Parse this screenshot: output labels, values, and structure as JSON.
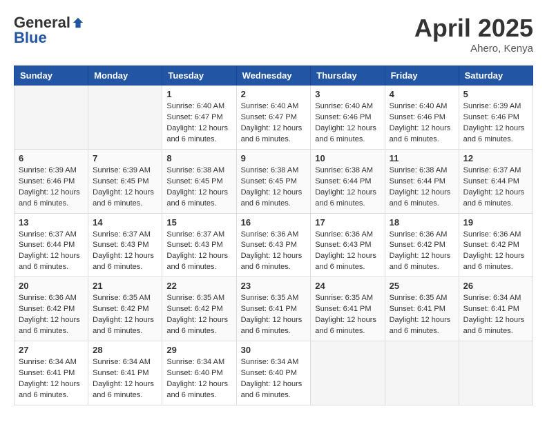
{
  "header": {
    "logo_general": "General",
    "logo_blue": "Blue",
    "month_title": "April 2025",
    "location": "Ahero, Kenya"
  },
  "columns": [
    "Sunday",
    "Monday",
    "Tuesday",
    "Wednesday",
    "Thursday",
    "Friday",
    "Saturday"
  ],
  "weeks": [
    [
      {
        "day": "",
        "info": ""
      },
      {
        "day": "",
        "info": ""
      },
      {
        "day": "1",
        "info": "Sunrise: 6:40 AM\nSunset: 6:47 PM\nDaylight: 12 hours and 6 minutes."
      },
      {
        "day": "2",
        "info": "Sunrise: 6:40 AM\nSunset: 6:47 PM\nDaylight: 12 hours and 6 minutes."
      },
      {
        "day": "3",
        "info": "Sunrise: 6:40 AM\nSunset: 6:46 PM\nDaylight: 12 hours and 6 minutes."
      },
      {
        "day": "4",
        "info": "Sunrise: 6:40 AM\nSunset: 6:46 PM\nDaylight: 12 hours and 6 minutes."
      },
      {
        "day": "5",
        "info": "Sunrise: 6:39 AM\nSunset: 6:46 PM\nDaylight: 12 hours and 6 minutes."
      }
    ],
    [
      {
        "day": "6",
        "info": "Sunrise: 6:39 AM\nSunset: 6:46 PM\nDaylight: 12 hours and 6 minutes."
      },
      {
        "day": "7",
        "info": "Sunrise: 6:39 AM\nSunset: 6:45 PM\nDaylight: 12 hours and 6 minutes."
      },
      {
        "day": "8",
        "info": "Sunrise: 6:38 AM\nSunset: 6:45 PM\nDaylight: 12 hours and 6 minutes."
      },
      {
        "day": "9",
        "info": "Sunrise: 6:38 AM\nSunset: 6:45 PM\nDaylight: 12 hours and 6 minutes."
      },
      {
        "day": "10",
        "info": "Sunrise: 6:38 AM\nSunset: 6:44 PM\nDaylight: 12 hours and 6 minutes."
      },
      {
        "day": "11",
        "info": "Sunrise: 6:38 AM\nSunset: 6:44 PM\nDaylight: 12 hours and 6 minutes."
      },
      {
        "day": "12",
        "info": "Sunrise: 6:37 AM\nSunset: 6:44 PM\nDaylight: 12 hours and 6 minutes."
      }
    ],
    [
      {
        "day": "13",
        "info": "Sunrise: 6:37 AM\nSunset: 6:44 PM\nDaylight: 12 hours and 6 minutes."
      },
      {
        "day": "14",
        "info": "Sunrise: 6:37 AM\nSunset: 6:43 PM\nDaylight: 12 hours and 6 minutes."
      },
      {
        "day": "15",
        "info": "Sunrise: 6:37 AM\nSunset: 6:43 PM\nDaylight: 12 hours and 6 minutes."
      },
      {
        "day": "16",
        "info": "Sunrise: 6:36 AM\nSunset: 6:43 PM\nDaylight: 12 hours and 6 minutes."
      },
      {
        "day": "17",
        "info": "Sunrise: 6:36 AM\nSunset: 6:43 PM\nDaylight: 12 hours and 6 minutes."
      },
      {
        "day": "18",
        "info": "Sunrise: 6:36 AM\nSunset: 6:42 PM\nDaylight: 12 hours and 6 minutes."
      },
      {
        "day": "19",
        "info": "Sunrise: 6:36 AM\nSunset: 6:42 PM\nDaylight: 12 hours and 6 minutes."
      }
    ],
    [
      {
        "day": "20",
        "info": "Sunrise: 6:36 AM\nSunset: 6:42 PM\nDaylight: 12 hours and 6 minutes."
      },
      {
        "day": "21",
        "info": "Sunrise: 6:35 AM\nSunset: 6:42 PM\nDaylight: 12 hours and 6 minutes."
      },
      {
        "day": "22",
        "info": "Sunrise: 6:35 AM\nSunset: 6:42 PM\nDaylight: 12 hours and 6 minutes."
      },
      {
        "day": "23",
        "info": "Sunrise: 6:35 AM\nSunset: 6:41 PM\nDaylight: 12 hours and 6 minutes."
      },
      {
        "day": "24",
        "info": "Sunrise: 6:35 AM\nSunset: 6:41 PM\nDaylight: 12 hours and 6 minutes."
      },
      {
        "day": "25",
        "info": "Sunrise: 6:35 AM\nSunset: 6:41 PM\nDaylight: 12 hours and 6 minutes."
      },
      {
        "day": "26",
        "info": "Sunrise: 6:34 AM\nSunset: 6:41 PM\nDaylight: 12 hours and 6 minutes."
      }
    ],
    [
      {
        "day": "27",
        "info": "Sunrise: 6:34 AM\nSunset: 6:41 PM\nDaylight: 12 hours and 6 minutes."
      },
      {
        "day": "28",
        "info": "Sunrise: 6:34 AM\nSunset: 6:41 PM\nDaylight: 12 hours and 6 minutes."
      },
      {
        "day": "29",
        "info": "Sunrise: 6:34 AM\nSunset: 6:40 PM\nDaylight: 12 hours and 6 minutes."
      },
      {
        "day": "30",
        "info": "Sunrise: 6:34 AM\nSunset: 6:40 PM\nDaylight: 12 hours and 6 minutes."
      },
      {
        "day": "",
        "info": ""
      },
      {
        "day": "",
        "info": ""
      },
      {
        "day": "",
        "info": ""
      }
    ]
  ]
}
